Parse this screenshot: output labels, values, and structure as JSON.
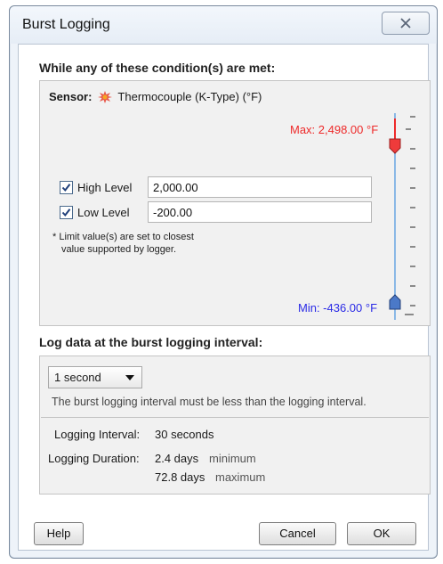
{
  "window": {
    "title": "Burst Logging"
  },
  "conditions": {
    "heading": "While any of these condition(s) are met:",
    "sensor_label": "Sensor:",
    "sensor_name": "Thermocouple (K-Type) (°F)",
    "high": {
      "checked": true,
      "label": "High Level",
      "value": "2,000.00"
    },
    "low": {
      "checked": true,
      "label": "Low Level",
      "value": "-200.00"
    },
    "note_line1": "* Limit value(s) are set to closest",
    "note_line2": "value supported by logger.",
    "max_label": "Max: 2,498.00 °F",
    "min_label": "Min: -436.00 °F",
    "colors": {
      "max": "#ee2a2a",
      "min": "#2a2ae6",
      "scale_line": "#8ab8e6"
    }
  },
  "burst": {
    "heading": "Log data at the burst logging interval:",
    "interval_select": "1 second",
    "interval_hint": "The burst logging interval must be less than the logging interval.",
    "logging_interval_label": "Logging Interval:",
    "logging_interval_value": "30 seconds",
    "logging_duration_label": "Logging Duration:",
    "duration_min_value": "2.4 days",
    "duration_min_note": "minimum",
    "duration_max_value": "72.8 days",
    "duration_max_note": "maximum"
  },
  "buttons": {
    "help": "Help",
    "cancel": "Cancel",
    "ok": "OK"
  }
}
